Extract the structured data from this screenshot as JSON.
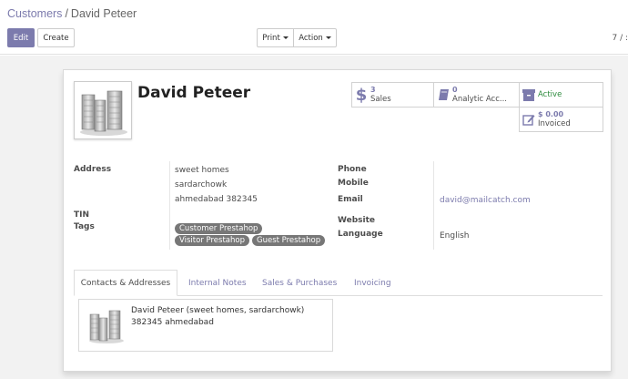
{
  "breadcrumb": {
    "parent": "Customers",
    "separator": "/",
    "current": "David Peteer"
  },
  "buttons": {
    "edit": "Edit",
    "create": "Create",
    "print": "Print",
    "action": "Action"
  },
  "pager": "7 / :",
  "partner": {
    "name": "David Peteer",
    "address_label": "Address",
    "address_lines": [
      "sweet homes",
      "sardarchowk",
      "ahmedabad 382345"
    ],
    "tin_label": "TIN",
    "tags_label": "Tags",
    "tags_row1": [
      "Customer Prestahop"
    ],
    "tags_row2": [
      "Visitor Prestahop",
      "Guest Prestahop"
    ],
    "phone_label": "Phone",
    "mobile_label": "Mobile",
    "email_label": "Email",
    "email": "david@mailcatch.com",
    "website_label": "Website",
    "language_label": "Language",
    "language": "English"
  },
  "smart_buttons": {
    "sales": {
      "count": "3",
      "label": "Sales"
    },
    "analytic": {
      "count": "0",
      "label": "Analytic Acc..."
    },
    "active": {
      "label": "Active"
    },
    "invoiced": {
      "amount": "$ 0.00",
      "label": "Invoiced"
    }
  },
  "tabs": [
    "Contacts & Addresses",
    "Internal Notes",
    "Sales & Purchases",
    "Invoicing"
  ],
  "contact_card": {
    "title": "David Peteer (sweet homes, sardarchowk)",
    "subtitle": "382345 ahmedabad"
  },
  "colors": {
    "accent": "#7c7bad",
    "active": "#2c8a3c",
    "tag": "#777777"
  }
}
